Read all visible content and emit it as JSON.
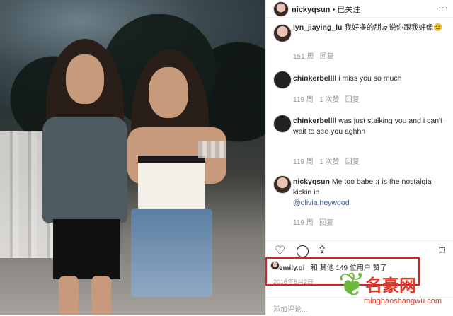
{
  "header": {
    "username": "nickyqsun",
    "follow_status": "• 已关注",
    "more_icon": "more-icon"
  },
  "comments": [
    {
      "user": "lyn_jiaying_lu",
      "text": "我好多的朋友说你跟我好像😊",
      "time": "151 周",
      "reply": "回复",
      "likes": ""
    },
    {
      "user": "chinkerbellll",
      "text": "i miss you so much",
      "time": "119 周",
      "reply": "回复",
      "likes": "1 次赞"
    },
    {
      "user": "chinkerbellll",
      "text": "was just stalking you and i can't wait to see you aghhh",
      "time": "119 周",
      "reply": "回复",
      "likes": "1 次赞"
    },
    {
      "user": "nickyqsun",
      "text": "Me too babe :( is the nostalgia kickin in",
      "mention": "@olivia.heywood",
      "time": "119 周",
      "reply": "回复",
      "likes": ""
    }
  ],
  "actions": {
    "like_icon": "heart-icon",
    "comment_icon": "comment-icon",
    "share_icon": "share-icon",
    "save_icon": "bookmark-icon"
  },
  "likes_line": {
    "user": "emily.qi_",
    "text": "和 其他 149 位用户 赞了"
  },
  "post_date": "2016年8月2日",
  "add_comment_placeholder": "添加评论...",
  "watermark": {
    "title": "名豪网",
    "url": "minghaoshangwu.com"
  },
  "colors": {
    "highlight": "#e02020",
    "watermark": "#e03a2a",
    "mention": "#385898"
  }
}
